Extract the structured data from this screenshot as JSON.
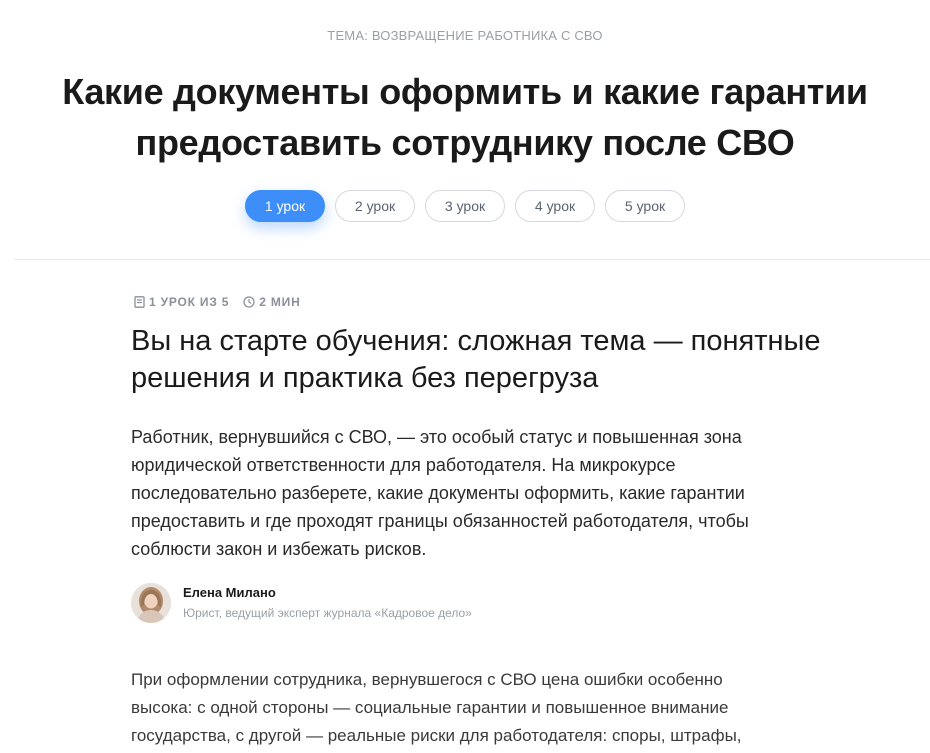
{
  "topic": "ТЕМА: ВОЗВРАЩЕНИЕ РАБОТНИКА С СВО",
  "title": "Какие документы оформить и какие гарантии предоставить сотруднику после СВО",
  "tabs": [
    {
      "label": "1 урок",
      "active": true
    },
    {
      "label": "2 урок",
      "active": false
    },
    {
      "label": "3 урок",
      "active": false
    },
    {
      "label": "4 урок",
      "active": false
    },
    {
      "label": "5 урок",
      "active": false
    }
  ],
  "meta": {
    "lesson": "1 урок из 5",
    "duration": "2 мин",
    "lesson_icon": "book-icon",
    "duration_icon": "clock-icon"
  },
  "lesson_title": "Вы на старте обучения: сложная тема — понятные решения и практика без перегруза",
  "lead": "Работник, вернувшийся с СВО, — это особый статус и повышенная зона юридической ответственности для работодателя. На микрокурсе последовательно разберете, какие документы оформить, какие гарантии предоставить и где проходят границы обязанностей работодателя, чтобы соблюсти закон и избежать рисков.",
  "author": {
    "name": "Елена Милано",
    "role": "Юрист, ведущий эксперт журнала «Кадровое дело»"
  },
  "body_text": "При оформлении сотрудника, вернувшегося с СВО цена ошибки особенно высока: с одной стороны — социальные гарантии и повышенное внимание государства, с другой — реальные риски для работодателя: споры, штрафы,",
  "colors": {
    "accent": "#3d8ef8",
    "muted": "#9aa0a6"
  }
}
